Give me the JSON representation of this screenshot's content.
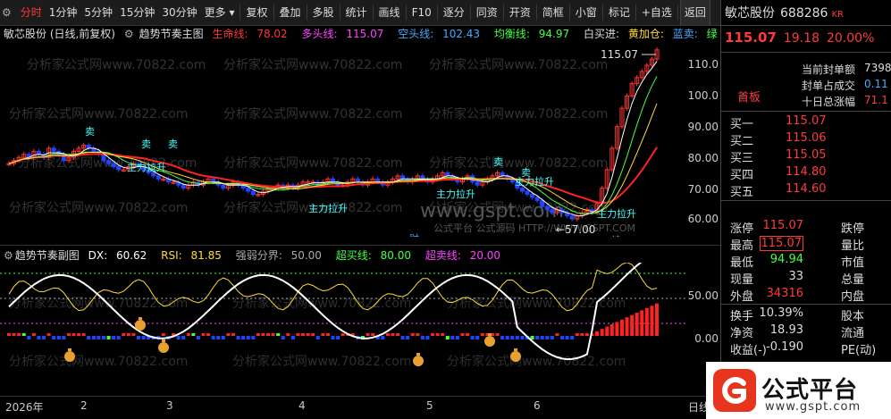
{
  "toolbar": {
    "tabs": [
      "分时",
      "1分钟",
      "5分钟",
      "15分钟",
      "30分钟",
      "更多"
    ],
    "buttons": [
      "复权",
      "叠加",
      "多股",
      "统计",
      "画线",
      "F10",
      "逐分",
      "同资",
      "开资",
      "简框",
      "小窗",
      "标记",
      "+自选",
      "返回"
    ]
  },
  "main_header": {
    "title": "敏芯股份 (日线,前复权)",
    "indicator": "趋势节奏主图",
    "items": [
      {
        "label": "生命线:",
        "value": "78.02",
        "color": "#ff3333"
      },
      {
        "label": "多头线:",
        "value": "115.07",
        "color": "#ff44ff"
      },
      {
        "label": "空头线:",
        "value": "102.43",
        "color": "#44aaff"
      },
      {
        "label": "均衡线:",
        "value": "94.97",
        "color": "#44ff44"
      }
    ],
    "extra": [
      "白买进:",
      "黄加仓:",
      "蓝卖:",
      "绿"
    ]
  },
  "price_axis": [
    "110.0",
    "100.0",
    "90.00",
    "80.00",
    "70.00",
    "60.00"
  ],
  "annotations": {
    "high_label": "115.07",
    "low_label": "←57.00",
    "sell": "卖",
    "lift": "主力拉升",
    "cai": "财",
    "bang": "榜"
  },
  "sub_header": {
    "indicator": "趋势节奏副图",
    "items": [
      {
        "label": "DX:",
        "value": "60.62",
        "color": "#ffffff"
      },
      {
        "label": "RSI:",
        "value": "81.85",
        "color": "#ffdd33"
      },
      {
        "label": "强弱分界:",
        "value": "50.00",
        "color": "#aaaaaa"
      },
      {
        "label": "超买线:",
        "value": "80.00",
        "color": "#44ff44"
      },
      {
        "label": "超卖线:",
        "value": "20.00",
        "color": "#ff44ff"
      }
    ]
  },
  "sub_axis": [
    "50.00",
    "0.00"
  ],
  "date_axis": {
    "start": "2026年",
    "months": [
      "2",
      "3",
      "4",
      "5",
      "6"
    ],
    "right_label": "日线"
  },
  "stock": {
    "name": "敏芯股份",
    "code": "688286",
    "badge": "KR",
    "price": "115.07",
    "change": "19.18",
    "pct": "20.00%",
    "seal_tag": "首板",
    "seal_items": [
      {
        "label": "当前封单额",
        "value": "7398"
      },
      {
        "label": "封单占成交",
        "value": "0.11"
      },
      {
        "label": "十日总涨幅",
        "value": "71.1"
      }
    ],
    "order_book": [
      {
        "label": "买一",
        "value": "115.07"
      },
      {
        "label": "买二",
        "value": "115.06"
      },
      {
        "label": "买三",
        "value": "115.05"
      },
      {
        "label": "买四",
        "value": "114.80"
      },
      {
        "label": "买五",
        "value": "114.60"
      }
    ],
    "stats_a": [
      {
        "l1": "涨停",
        "v1": "115.07",
        "c1": "#ff3a3a",
        "l2": "跌停"
      },
      {
        "l1": "最高",
        "v1": "115.07",
        "c1": "#ff3a3a",
        "l2": "量比"
      },
      {
        "l1": "最低",
        "v1": "94.94",
        "c1": "#44ff44",
        "l2": "市值"
      },
      {
        "l1": "现量",
        "v1": "33",
        "c1": "#ddd",
        "l2": "总量"
      },
      {
        "l1": "外盘",
        "v1": "34316",
        "c1": "#ff3a3a",
        "l2": "内盘"
      }
    ],
    "stats_b": [
      {
        "l1": "换手",
        "v1": "10.39%",
        "c1": "#ddd",
        "l2": "股本"
      },
      {
        "l1": "净资",
        "v1": "18.93",
        "c1": "#ddd",
        "l2": "流通"
      },
      {
        "l1": "收益(-)",
        "v1": "-0.190",
        "c1": "#ddd",
        "l2": "PE(动)"
      }
    ]
  },
  "logo": {
    "text": "公式平台",
    "url": "www.gspt.com"
  },
  "watermark": "分析家公式网www.70822.com",
  "watermark2": "www.gspt.com",
  "watermark3": "公式平台 公式源码 HTTP://WWW.GSPT.COM",
  "colors": {
    "up": "#ff3333",
    "down": "#2244ff",
    "accent": "#ff3a3a"
  }
}
